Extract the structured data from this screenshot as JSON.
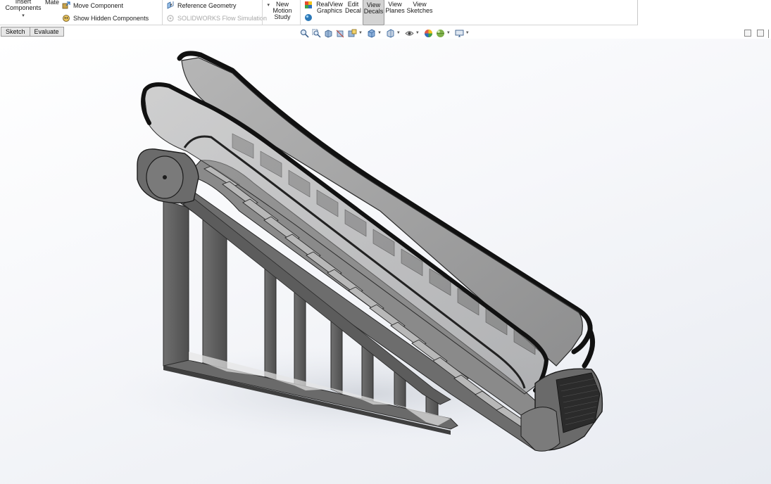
{
  "ribbon": {
    "insert_components": "Insert\nComponents",
    "mate": "Mate",
    "move_component": "Move Component",
    "show_hidden_components": "Show Hidden Components",
    "reference_geometry": "Reference Geometry",
    "flow_simulation": "SOLIDWORKS Flow Simulation",
    "new_motion_study": "New\nMotion\nStudy",
    "realview_graphics": "RealView\nGraphics",
    "edit_decal": "Edit\nDecal",
    "view_decals": "View\nDecals",
    "view_planes": "View\nPlanes",
    "view_sketches": "View\nSketches"
  },
  "tabs": [
    "Sketch",
    "Evaluate"
  ],
  "heads_up_toolbar": {
    "icons": [
      "zoom-to-fit-icon",
      "zoom-to-area-icon",
      "previous-view-icon",
      "section-view-icon",
      "dynamic-annotation-icon",
      "view-orientation-icon",
      "display-style-icon",
      "hide-show-items-icon",
      "edit-appearance-icon",
      "apply-scene-icon",
      "view-settings-icon"
    ]
  },
  "colors": {
    "ribbon_bg": "#ffffff",
    "tab_bg": "#e7e7e7",
    "active_button_bg": "#d3d3d3",
    "viewport_bg_start": "#ffffff",
    "viewport_bg_end": "#e8ebf1",
    "model_frame": "#5d5d5d",
    "handrail": "#111111",
    "balustrade_glass": "#8f8f8f"
  }
}
